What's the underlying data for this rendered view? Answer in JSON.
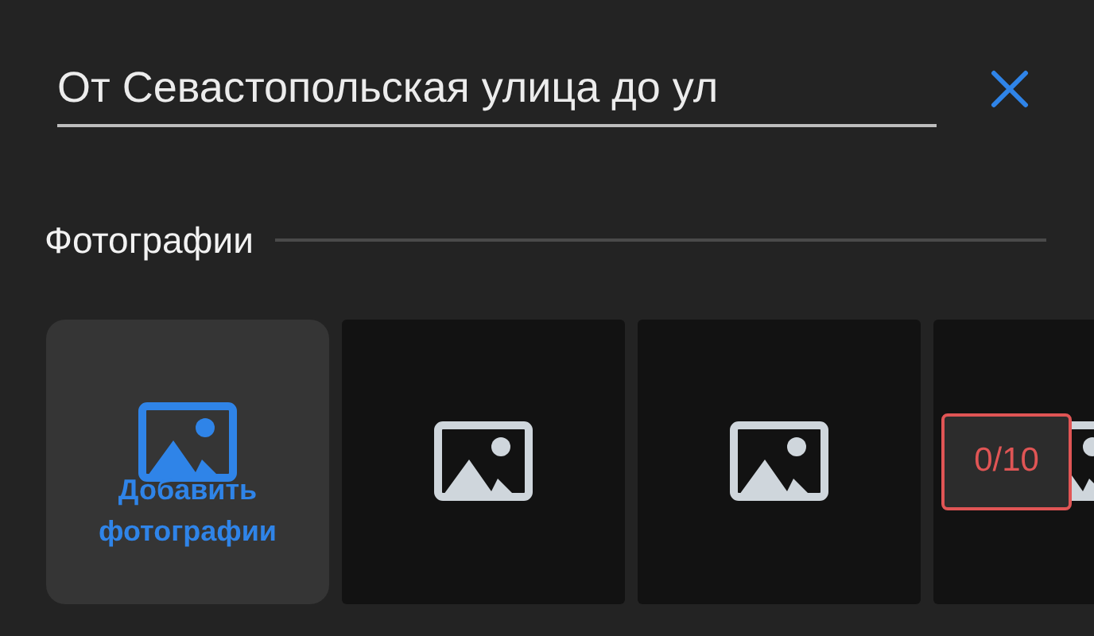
{
  "title_field": {
    "value": "От Севастопольская улица до ул"
  },
  "photos_section": {
    "heading": "Фотографии",
    "slots": [
      {
        "kind": "add",
        "label": "Добавить фотографии"
      },
      {
        "kind": "empty"
      },
      {
        "kind": "empty"
      },
      {
        "kind": "empty"
      }
    ],
    "counter": "0/10"
  }
}
